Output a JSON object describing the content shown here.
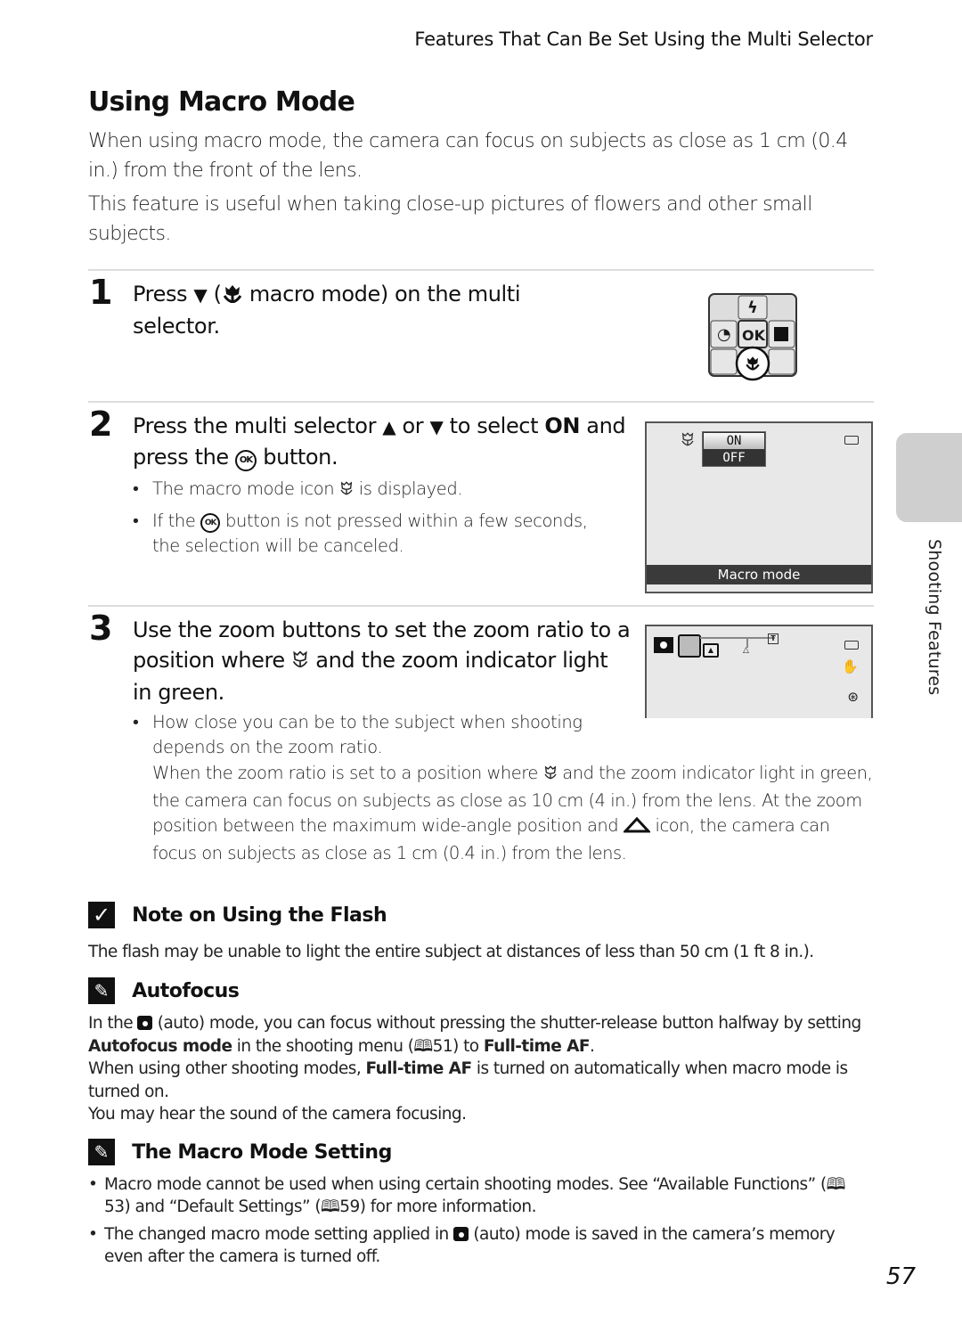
{
  "header": {
    "running_head": "Features That Can Be Set Using the Multi Selector"
  },
  "page": {
    "title": "Using Macro Mode",
    "intro": [
      "When using macro mode, the camera can focus on subjects as close as 1 cm (0.4 in.) from the front of the lens.",
      "This feature is useful when taking close-up pictures of flowers and other small subjects."
    ],
    "page_number": "57",
    "side_tab_label": "Shooting Features"
  },
  "steps": [
    {
      "number": "1",
      "text_before": "Press ",
      "down_arrow": "▼",
      "paren_open": " (",
      "text_after": " macro mode) on the multi selector."
    },
    {
      "number": "2",
      "text_before": "Press the multi selector ",
      "up_arrow": "▲",
      "or": " or ",
      "down_arrow": "▼",
      "to_select": " to select ",
      "on_label": "ON",
      "and_press": " and press the ",
      "ok_label": "OK",
      "button_word": " button.",
      "bullets": [
        {
          "before": "The macro mode icon ",
          "after": " is displayed."
        },
        {
          "before": "If the ",
          "after": " button is not pressed within a few seconds, the selection will be canceled."
        }
      ]
    },
    {
      "number": "3",
      "text_before": "Use the zoom buttons to set the zoom ratio to a position where ",
      "text_after": " and the zoom indicator light in green.",
      "bullet": "How close you can be to the subject when shooting depends on the zoom ratio.",
      "detail_before": "When the zoom ratio is set to a position where ",
      "detail_mid": " and the zoom indicator light in green, the camera can focus on subjects as close as 10 cm (4 in.) from the lens. At the zoom position between the maximum wide-angle position and ",
      "detail_after": " icon, the camera can focus on subjects as close as 1 cm (0.4 in.) from the lens."
    }
  ],
  "multi_selector": {
    "top": "flash-icon",
    "left": "self-timer-icon",
    "center": "OK",
    "right": "exposure-compensation-icon",
    "bottom": "macro-icon"
  },
  "screen_macro": {
    "options": [
      "ON",
      "OFF"
    ],
    "selected": "ON",
    "label": "Macro mode"
  },
  "screen_zoom": {
    "tele_label": "T"
  },
  "notes": {
    "flash": {
      "icon": "check-icon",
      "title": "Note on Using the Flash",
      "body": "The flash may be unable to light the entire subject at distances of less than 50 cm (1 ft 8 in.)."
    },
    "autofocus": {
      "icon": "pencil-icon",
      "title": "Autofocus",
      "p1_a": "In the ",
      "p1_b": " (auto) mode, you can focus without pressing the shutter-release button halfway by setting ",
      "p1_bold1": "Autofocus mode",
      "p1_c": " in the shooting menu (",
      "p1_ref": "51",
      "p1_d": ") to ",
      "p1_bold2": "Full-time AF",
      "p1_e": ".",
      "p2_a": "When using other shooting modes, ",
      "p2_bold": "Full-time AF",
      "p2_b": " is turned on automatically when macro mode is turned on.",
      "p3": "You may hear the sound of the camera focusing."
    },
    "macro_setting": {
      "icon": "pencil-icon",
      "title": "The Macro Mode Setting",
      "b1_a": "Macro mode cannot be used when using certain shooting modes. See “Available Functions” (",
      "b1_ref1": "53",
      "b1_b": ") and “Default Settings” (",
      "b1_ref2": "59",
      "b1_c": ") for more information.",
      "b2_a": "The changed macro mode setting applied in ",
      "b2_b": " (auto) mode is saved in the camera’s memory even after the camera is turned off."
    }
  },
  "glyphs": {
    "book": "🕮",
    "check": "✓",
    "pencil": "✎"
  }
}
